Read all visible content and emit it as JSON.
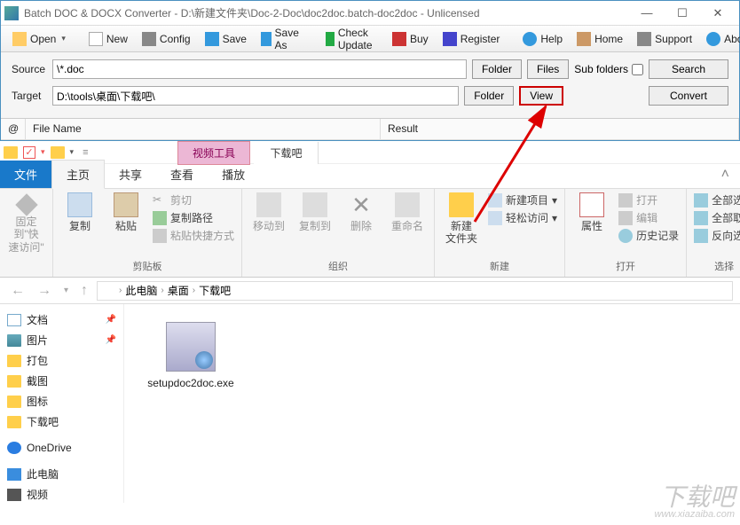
{
  "app1": {
    "title": "Batch DOC & DOCX Converter - D:\\新建文件夹\\Doc-2-Doc\\doc2doc.batch-doc2doc - Unlicensed",
    "toolbar": {
      "open": "Open",
      "new": "New",
      "config": "Config",
      "save": "Save",
      "save_as": "Save As",
      "check_update": "Check Update",
      "buy": "Buy",
      "register": "Register",
      "help": "Help",
      "home": "Home",
      "support": "Support",
      "about": "About"
    },
    "form": {
      "source_label": "Source",
      "source_value": "\\*.doc",
      "target_label": "Target",
      "target_value": "D:\\tools\\桌面\\下载吧\\",
      "folder_btn": "Folder",
      "files_btn": "Files",
      "sub_folders_label": "Sub folders",
      "sub_folders_checked": false,
      "search_btn": "Search",
      "view_btn": "View",
      "convert_btn": "Convert"
    },
    "grid": {
      "at": "@",
      "file_name": "File Name",
      "result": "Result"
    }
  },
  "app2": {
    "context_label": "视频工具",
    "context_tab": "下载吧",
    "tabs": {
      "file": "文件",
      "home": "主页",
      "share": "共享",
      "view": "查看",
      "play": "播放"
    },
    "ribbon": {
      "pin_group": {
        "pin": "固定到\"快\n速访问\""
      },
      "clipboard": {
        "copy": "复制",
        "paste": "粘贴",
        "cut": "剪切",
        "copy_path": "复制路径",
        "paste_shortcut": "粘贴快捷方式",
        "name": "剪贴板"
      },
      "organize": {
        "move_to": "移动到",
        "copy_to": "复制到",
        "delete": "删除",
        "rename": "重命名",
        "name": "组织"
      },
      "new_group": {
        "new_folder": "新建\n文件夹",
        "new_item": "新建项目",
        "easy_access": "轻松访问",
        "name": "新建"
      },
      "open_group": {
        "properties": "属性",
        "open": "打开",
        "edit": "编辑",
        "history": "历史记录",
        "name": "打开"
      },
      "select": {
        "select_all": "全部选择",
        "select_none": "全部取消",
        "invert": "反向选择",
        "name": "选择"
      }
    },
    "breadcrumbs": [
      "此电脑",
      "桌面",
      "下载吧"
    ],
    "sidebar": {
      "items": [
        {
          "label": "文档",
          "icon": "doc"
        },
        {
          "label": "图片",
          "icon": "pic"
        },
        {
          "label": "打包",
          "icon": "folder"
        },
        {
          "label": "截图",
          "icon": "folder"
        },
        {
          "label": "图标",
          "icon": "folder"
        },
        {
          "label": "下载吧",
          "icon": "folder"
        }
      ],
      "onedrive": "OneDrive",
      "this_pc": "此电脑",
      "video": "视频"
    },
    "file": {
      "name": "setupdoc2doc.exe"
    }
  },
  "watermark": {
    "main": "下载吧",
    "url": "www.xiazaiba.com"
  }
}
